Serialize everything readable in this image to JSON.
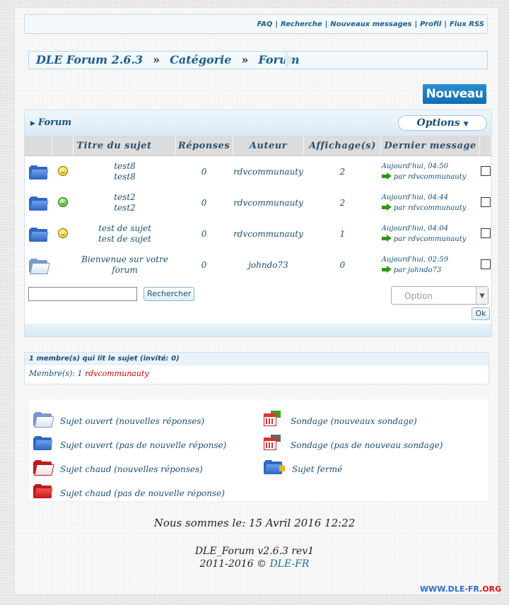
{
  "toplinks": [
    {
      "label": "FAQ"
    },
    {
      "label": "Recherche"
    },
    {
      "label": "Nouveaux messages"
    },
    {
      "label": "Profil"
    },
    {
      "label": "Flux RSS"
    }
  ],
  "breadcrumb": {
    "home": "DLE Forum 2.6.3",
    "category": "Catégorie",
    "forum": "Forum",
    "arrow": "»"
  },
  "new_button": "Nouveau",
  "forum": {
    "title": "Forum",
    "options_label": "Options",
    "columns": {
      "title": "Titre du sujet",
      "replies": "Réponses",
      "author": "Auteur",
      "views": "Affichage(s)",
      "last": "Dernier message"
    },
    "topics": [
      {
        "title": "test8",
        "desc": "test8",
        "replies": "0",
        "author": "rdvcommunauty",
        "views": "2",
        "last_date": "Aujourd'hui, 04:50",
        "last_by": "par rdvcommunauty",
        "status_icon": "folder-new",
        "emoticon": "smile-glasses"
      },
      {
        "title": "test2",
        "desc": "test2",
        "replies": "0",
        "author": "rdvcommunauty",
        "views": "2",
        "last_date": "Aujourd'hui, 04:44",
        "last_by": "par rdvcommunauty",
        "status_icon": "folder-new",
        "emoticon": "smile-green"
      },
      {
        "title": "test de sujet",
        "desc": "test de sujet",
        "replies": "0",
        "author": "rdvcommunauty",
        "views": "1",
        "last_date": "Aujourd'hui, 04:04",
        "last_by": "par rdvcommunauty",
        "status_icon": "folder-new",
        "emoticon": "smile"
      },
      {
        "title": "Bienvenue sur votre",
        "desc": "forum",
        "replies": "0",
        "author": "johndo73",
        "views": "0",
        "last_date": "Aujourd'hui, 02:59",
        "last_by": "par johndo73",
        "status_icon": "folder-open",
        "emoticon": ""
      }
    ],
    "search_value": "",
    "search_button": "Rechercher",
    "option_select": "Option",
    "ok_button": "Ok"
  },
  "members": {
    "header": "1 membre(s) qui lit le sujet (invité: 0)",
    "prefix": "Membre(s): 1",
    "user": "rdvcommunauty"
  },
  "legend": [
    {
      "label": "Sujet ouvert (nouvelles réponses)",
      "icon": "folder-white-icon"
    },
    {
      "label": "Sujet ouvert (pas de nouvelle réponse)",
      "icon": "folder-blue-icon"
    },
    {
      "label": "Sujet chaud (nouvelles réponses)",
      "icon": "folder-red-white-icon"
    },
    {
      "label": "Sujet chaud (pas de nouvelle réponse)",
      "icon": "folder-red-icon"
    },
    {
      "label": "Sondage (nouveaux sondage)",
      "icon": "poll-green-icon"
    },
    {
      "label": "Sondage (pas de nouveau sondage)",
      "icon": "poll-grey-icon"
    },
    {
      "label": "Sujet fermé",
      "icon": "folder-locked-icon"
    }
  ],
  "footer": {
    "date": "Nous sommes le: 15 Avril 2016 12:22",
    "version": "DLE_Forum v2.6.3 rev1",
    "copyright": "2011-2016 ©",
    "copyright_link": "DLE-FR"
  },
  "watermark": {
    "main": "WWW.DLE-FR",
    "tld": ".ORG"
  },
  "colors": {
    "accent": "#1a5e8f",
    "button": "#0f6db2",
    "highlight_user": "#d10000"
  }
}
